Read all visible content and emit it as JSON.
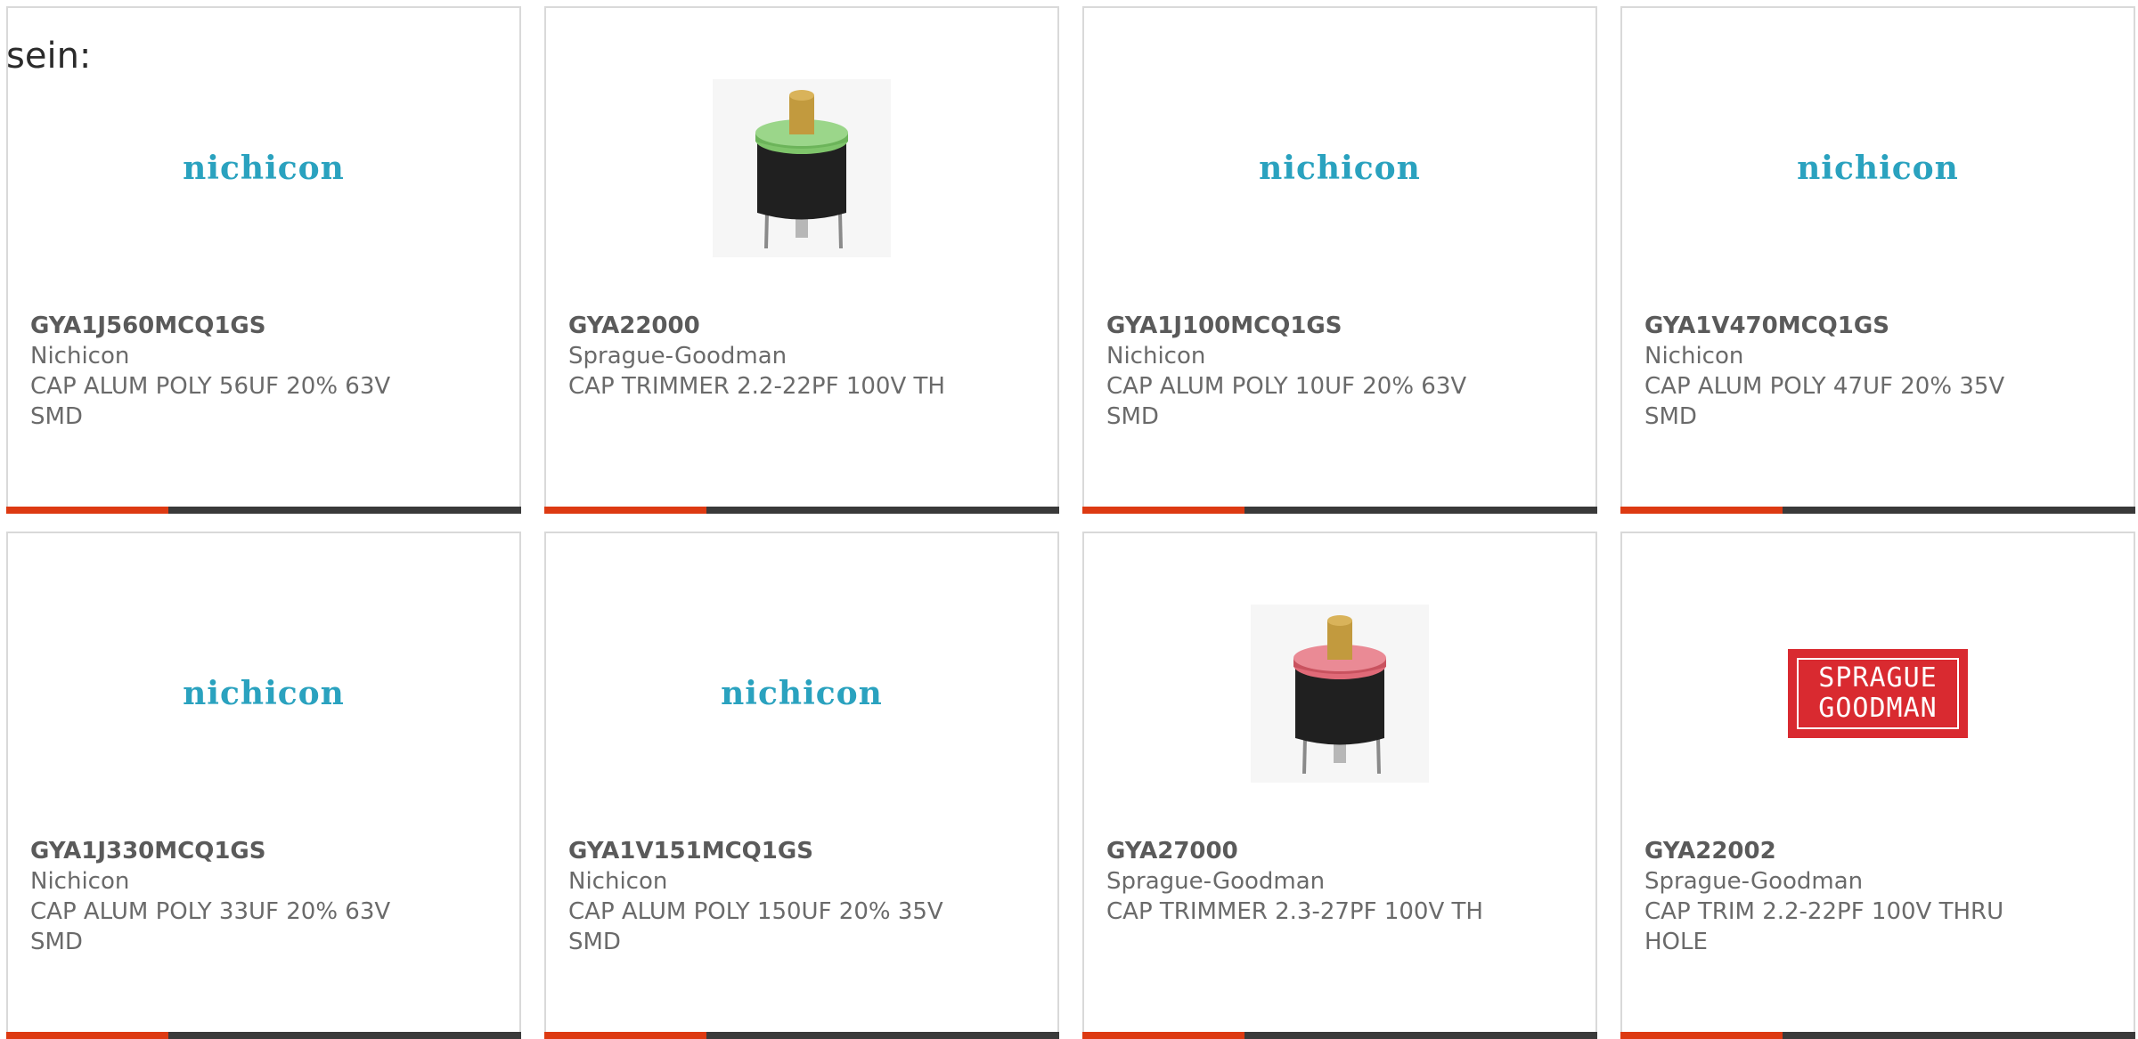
{
  "intro_text": "sein:",
  "colors": {
    "accent": "#dd3a12",
    "bar": "#3a3a3a",
    "nichicon": "#2aa2bf",
    "sprague_red": "#d92a30",
    "trimmer_green": "#7fc56b",
    "trimmer_pink": "#e06a78"
  },
  "products": [
    {
      "part_number": "GYA1J560MCQ1GS",
      "manufacturer": "Nichicon",
      "description": "CAP ALUM POLY 56UF 20% 63V SMD",
      "image": "nichicon-logo",
      "logo_text": "nichicon"
    },
    {
      "part_number": "GYA22000",
      "manufacturer": "Sprague-Goodman",
      "description": "CAP TRIMMER 2.2-22PF 100V TH",
      "image": "trimmer-capacitor-green"
    },
    {
      "part_number": "GYA1J100MCQ1GS",
      "manufacturer": "Nichicon",
      "description": "CAP ALUM POLY 10UF 20% 63V SMD",
      "image": "nichicon-logo",
      "logo_text": "nichicon"
    },
    {
      "part_number": "GYA1V470MCQ1GS",
      "manufacturer": "Nichicon",
      "description": "CAP ALUM POLY 47UF 20% 35V SMD",
      "image": "nichicon-logo",
      "logo_text": "nichicon"
    },
    {
      "part_number": "GYA1J330MCQ1GS",
      "manufacturer": "Nichicon",
      "description": "CAP ALUM POLY 33UF 20% 63V SMD",
      "image": "nichicon-logo",
      "logo_text": "nichicon"
    },
    {
      "part_number": "GYA1V151MCQ1GS",
      "manufacturer": "Nichicon",
      "description": "CAP ALUM POLY 150UF 20% 35V SMD",
      "image": "nichicon-logo",
      "logo_text": "nichicon"
    },
    {
      "part_number": "GYA27000",
      "manufacturer": "Sprague-Goodman",
      "description": "CAP TRIMMER 2.3-27PF 100V TH",
      "image": "trimmer-capacitor-pink"
    },
    {
      "part_number": "GYA22002",
      "manufacturer": "Sprague-Goodman",
      "description": "CAP TRIM 2.2-22PF 100V THRU HOLE",
      "image": "sprague-goodman-logo",
      "logo_lines": [
        "SPRAGUE",
        "GOODMAN"
      ]
    }
  ]
}
